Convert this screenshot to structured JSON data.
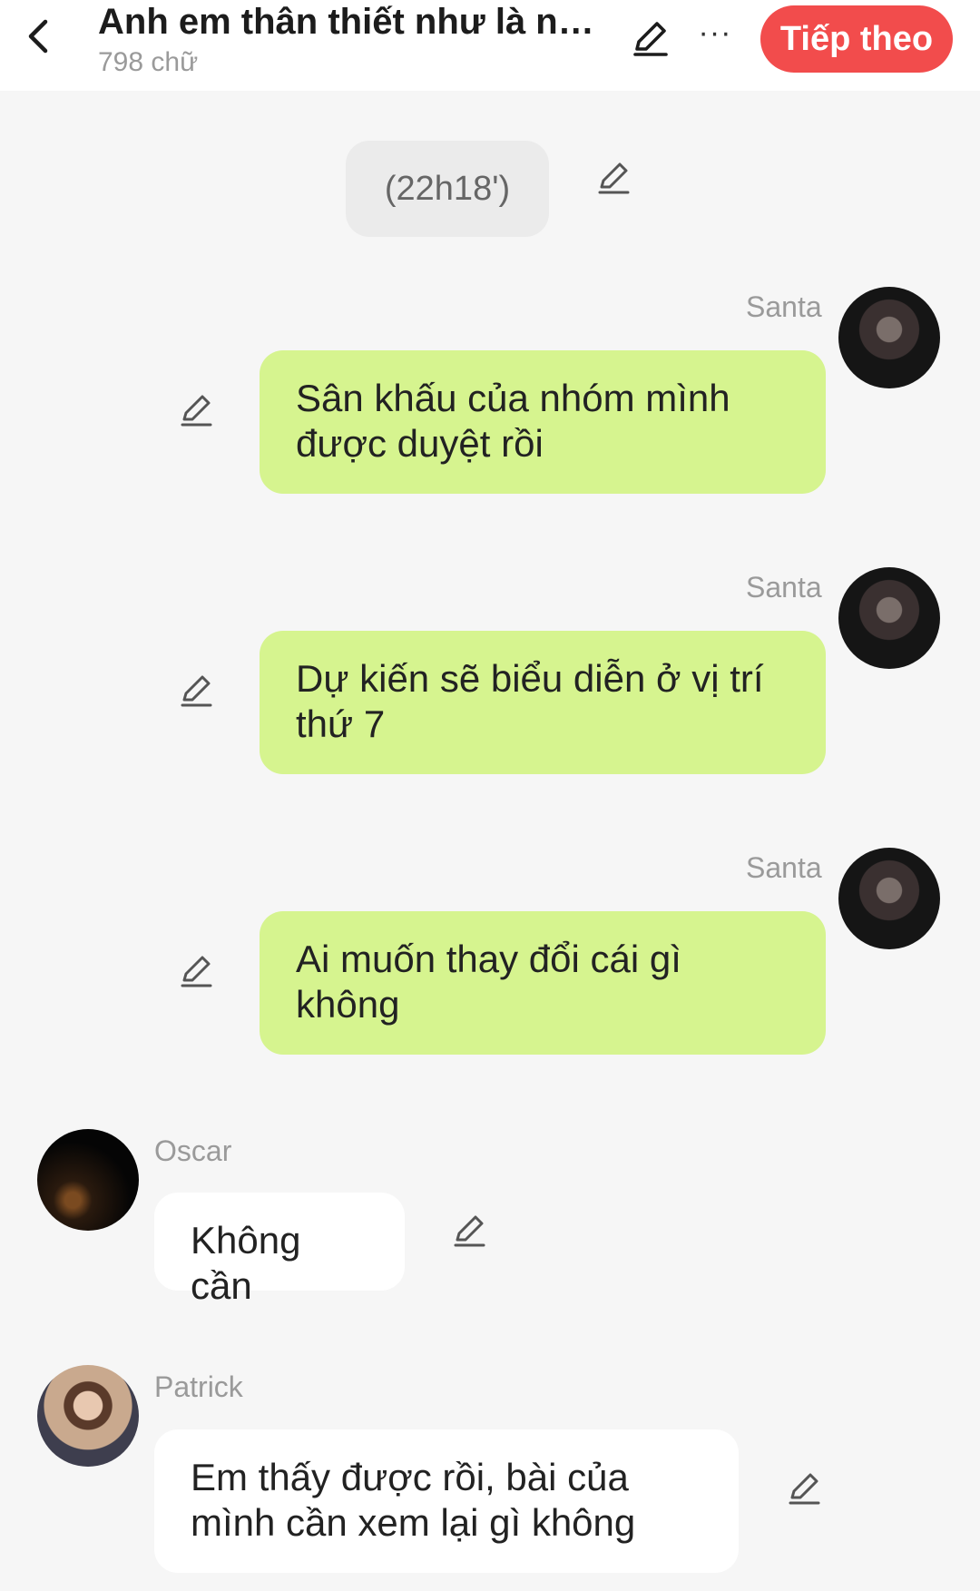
{
  "header": {
    "title": "Anh em thân thiết như là ng...",
    "word_count": "798 chữ",
    "next_label": "Tiếp theo",
    "more_label": "···"
  },
  "time_marker": "(22h18')",
  "messages": [
    {
      "sender": "Santa",
      "side": "right",
      "text": "Sân khấu của nhóm mình được duyệt rồi"
    },
    {
      "sender": "Santa",
      "side": "right",
      "text": "Dự kiến sẽ biểu diễn ở vị trí thứ 7"
    },
    {
      "sender": "Santa",
      "side": "right",
      "text": "Ai muốn thay đổi cái gì không"
    },
    {
      "sender": "Oscar",
      "side": "left",
      "text": "Không cần"
    },
    {
      "sender": "Patrick",
      "side": "left",
      "text": "Em thấy được rồi, bài của mình cần xem lại gì không"
    }
  ],
  "colors": {
    "accent": "#f24c4c",
    "right_bubble": "#d6f48f",
    "left_bubble": "#ffffff",
    "background": "#f6f6f6"
  },
  "icons": {
    "back": "chevron-left-icon",
    "edit": "pencil-icon",
    "more": "more-horizontal-icon"
  }
}
